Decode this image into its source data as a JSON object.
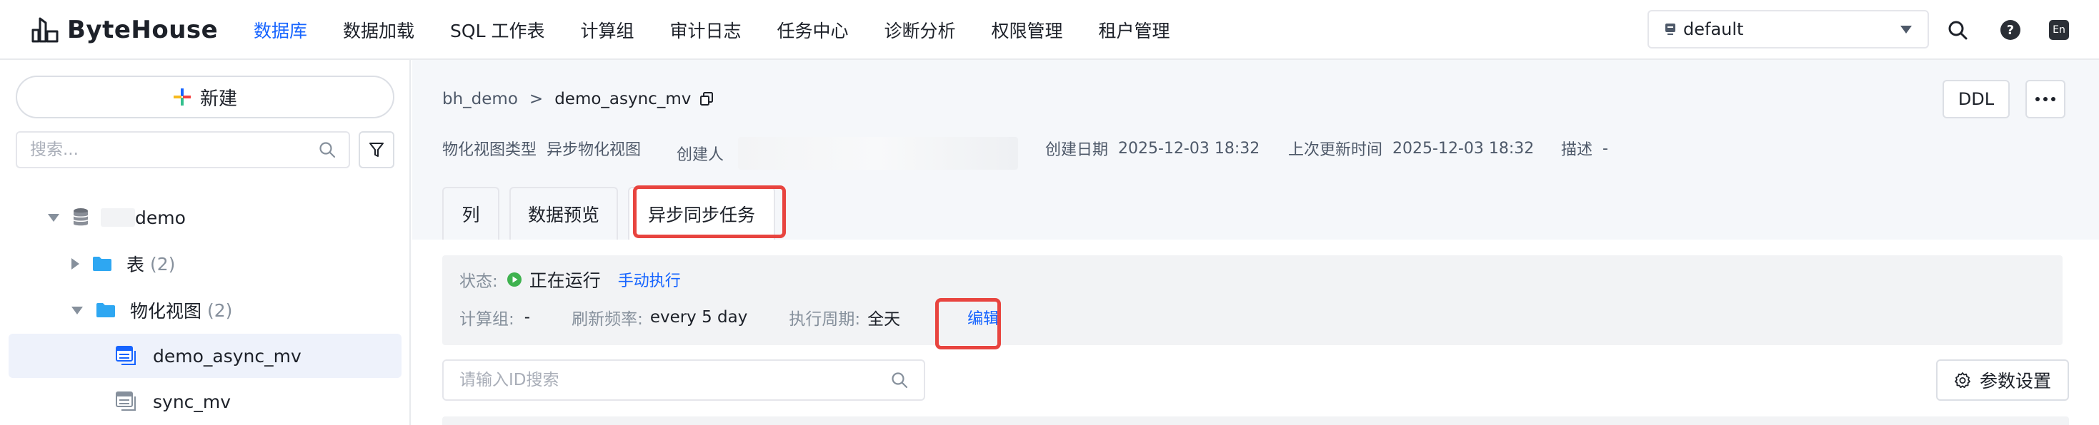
{
  "brand": {
    "name": "ByteHouse"
  },
  "nav": {
    "items": [
      {
        "label": "数据库",
        "active": true
      },
      {
        "label": "数据加载",
        "active": false
      },
      {
        "label": "SQL 工作表",
        "active": false
      },
      {
        "label": "计算组",
        "active": false
      },
      {
        "label": "审计日志",
        "active": false
      },
      {
        "label": "任务中心",
        "active": false
      },
      {
        "label": "诊断分析",
        "active": false
      },
      {
        "label": "权限管理",
        "active": false
      },
      {
        "label": "租户管理",
        "active": false
      }
    ],
    "workspace": "default",
    "lang_badge": "En"
  },
  "sidebar": {
    "new_button": "新建",
    "search_placeholder": "搜索...",
    "tree": {
      "database": "demo",
      "tables": {
        "label": "表",
        "count": "(2)"
      },
      "views": {
        "label": "物化视图",
        "count": "(2)"
      },
      "view_items": [
        "demo_async_mv",
        "sync_mv"
      ]
    }
  },
  "header": {
    "breadcrumb_parent": "bh_demo",
    "breadcrumb_sep": ">",
    "breadcrumb_current": "demo_async_mv",
    "ddl_button": "DDL",
    "meta": {
      "type_label": "物化视图类型",
      "type_value": "异步物化视图",
      "creator_label": "创建人",
      "created_label": "创建日期",
      "created_value": "2025-12-03 18:32",
      "updated_label": "上次更新时间",
      "updated_value": "2025-12-03 18:32",
      "desc_label": "描述",
      "desc_value": "-"
    }
  },
  "tabs": [
    {
      "label": "列",
      "active": false
    },
    {
      "label": "数据预览",
      "active": false
    },
    {
      "label": "异步同步任务",
      "active": true
    }
  ],
  "task": {
    "status_label": "状态:",
    "status_value": "正在运行",
    "manual_run": "手动执行",
    "compute_label": "计算组:",
    "compute_value": "-",
    "refresh_label": "刷新频率:",
    "refresh_value": "every 5 day",
    "period_label": "执行周期:",
    "period_value": "全天",
    "edit_link": "编辑"
  },
  "toolbar": {
    "id_search_placeholder": "请输入ID搜索",
    "params_button": "参数设置"
  },
  "colors": {
    "accent": "#1664ff",
    "highlight": "#e8443f",
    "running": "#3fb24f"
  }
}
